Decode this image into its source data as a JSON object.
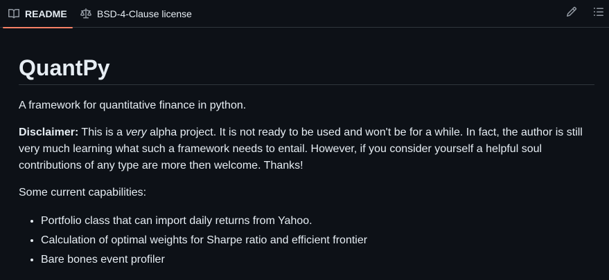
{
  "tabs": {
    "readme_label": "README",
    "license_label": "BSD-4-Clause license"
  },
  "toolbar": {
    "edit_icon": "pencil-icon",
    "outline_icon": "list-unordered-icon"
  },
  "readme": {
    "title": "QuantPy",
    "intro": "A framework for quantitative finance in python.",
    "disclaimer": {
      "label": "Disclaimer:",
      "before": " This is a ",
      "emphasis": "very",
      "after": " alpha project. It is not ready to be used and won't be for a while. In fact, the author is still very much learning what such a framework needs to entail. However, if you consider yourself a helpful soul contributions of any type are more then welcome. Thanks!"
    },
    "capabilities_heading": "Some current capabilities:",
    "capabilities": [
      "Portfolio class that can import daily returns from Yahoo.",
      "Calculation of optimal weights for Sharpe ratio and efficient frontier",
      "Bare bones event profiler"
    ]
  },
  "colors": {
    "background": "#0d1117",
    "text": "#e6edf3",
    "border": "#30363d",
    "tab_underline": "#f78166",
    "icon": "#9198a1"
  }
}
